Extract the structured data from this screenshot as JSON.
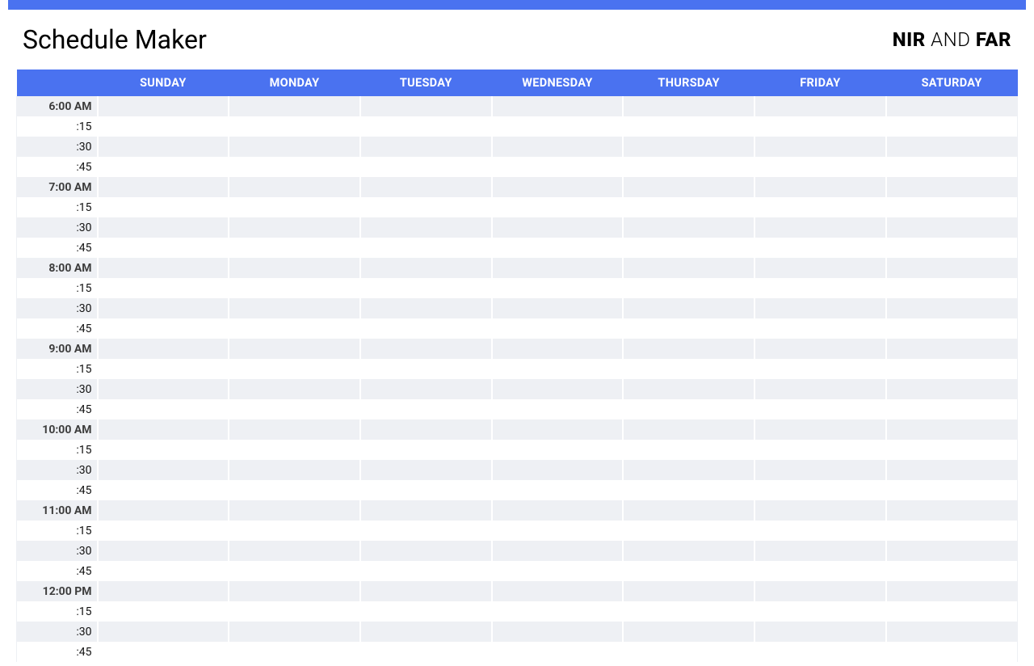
{
  "title": "Schedule Maker",
  "brand": {
    "part1": "NIR",
    "part2": " AND ",
    "part3": "FAR"
  },
  "days": [
    "SUNDAY",
    "MONDAY",
    "TUESDAY",
    "WEDNESDAY",
    "THURSDAY",
    "FRIDAY",
    "SATURDAY"
  ],
  "time_rows": [
    {
      "label": "6:00 AM",
      "major": true
    },
    {
      "label": ":15",
      "major": false
    },
    {
      "label": ":30",
      "major": false
    },
    {
      "label": ":45",
      "major": false
    },
    {
      "label": "7:00 AM",
      "major": true
    },
    {
      "label": ":15",
      "major": false
    },
    {
      "label": ":30",
      "major": false
    },
    {
      "label": ":45",
      "major": false
    },
    {
      "label": "8:00 AM",
      "major": true
    },
    {
      "label": ":15",
      "major": false
    },
    {
      "label": ":30",
      "major": false
    },
    {
      "label": ":45",
      "major": false
    },
    {
      "label": "9:00 AM",
      "major": true
    },
    {
      "label": ":15",
      "major": false
    },
    {
      "label": ":30",
      "major": false
    },
    {
      "label": ":45",
      "major": false
    },
    {
      "label": "10:00 AM",
      "major": true
    },
    {
      "label": ":15",
      "major": false
    },
    {
      "label": ":30",
      "major": false
    },
    {
      "label": ":45",
      "major": false
    },
    {
      "label": "11:00 AM",
      "major": true
    },
    {
      "label": ":15",
      "major": false
    },
    {
      "label": ":30",
      "major": false
    },
    {
      "label": ":45",
      "major": false
    },
    {
      "label": "12:00 PM",
      "major": true
    },
    {
      "label": ":15",
      "major": false
    },
    {
      "label": ":30",
      "major": false
    },
    {
      "label": ":45",
      "major": false
    }
  ]
}
